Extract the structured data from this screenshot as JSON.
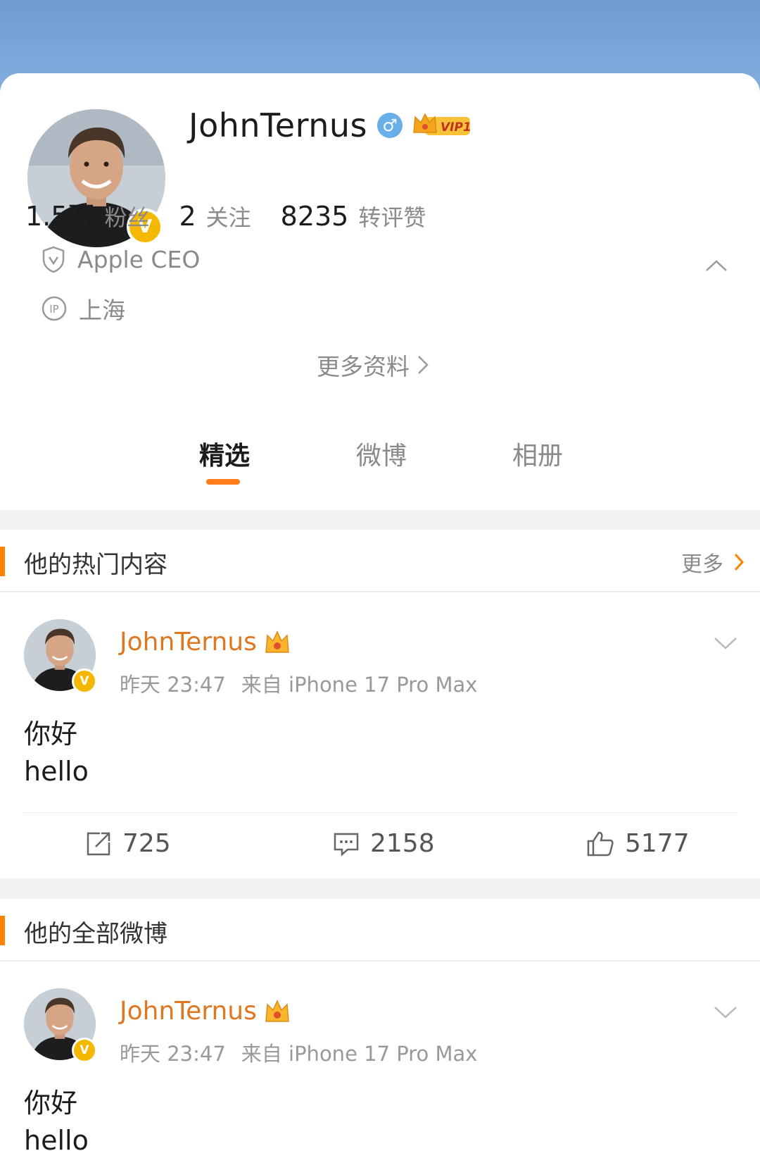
{
  "profile": {
    "name": "JohnTernus",
    "gender_symbol": "♂",
    "vip_label": "VIP1",
    "verified_mark": "V",
    "stats": [
      {
        "value": "1.5万",
        "label": "粉丝"
      },
      {
        "value": "2",
        "label": "关注"
      },
      {
        "value": "8235",
        "label": "转评赞"
      }
    ],
    "title": "Apple CEO",
    "ip_location": "上海",
    "ip_icon_text": "IP",
    "more_info_label": "更多资料"
  },
  "tabs": [
    {
      "label": "精选",
      "active": true
    },
    {
      "label": "微博",
      "active": false
    },
    {
      "label": "相册",
      "active": false
    }
  ],
  "hot_section": {
    "title": "他的热门内容",
    "more_label": "更多",
    "post": {
      "author": "JohnTernus",
      "time": "昨天 23:47",
      "source": "来自 iPhone 17 Pro Max",
      "lines": [
        "你好",
        "hello"
      ],
      "reposts": "725",
      "comments": "2158",
      "likes": "5177"
    }
  },
  "all_section": {
    "title": "他的全部微博",
    "post": {
      "author": "JohnTernus",
      "time": "昨天 23:47",
      "source": "来自 iPhone 17 Pro Max",
      "lines": [
        "你好",
        "hello"
      ]
    }
  },
  "colors": {
    "accent_orange": "#ff8200",
    "author_orange": "#e0771f",
    "verified_gold": "#f5b800",
    "banner_blue": "#7aa6dc"
  }
}
